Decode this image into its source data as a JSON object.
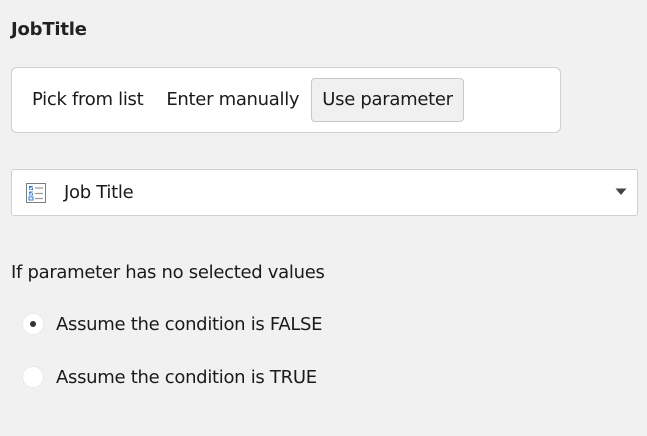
{
  "panel": {
    "title": "JobTitle"
  },
  "mode_options": {
    "pick_from_list": "Pick from list",
    "enter_manually": "Enter manually",
    "use_parameter": "Use parameter",
    "selected": "use_parameter"
  },
  "parameter_select": {
    "icon": "checklist-icon",
    "value": "Job Title"
  },
  "no_values": {
    "label": "If parameter has no selected values",
    "options": [
      {
        "label": "Assume the condition is FALSE",
        "checked": true
      },
      {
        "label": "Assume the condition is TRUE",
        "checked": false
      }
    ]
  },
  "colors": {
    "background": "#f1f1f1",
    "surface": "#ffffff",
    "border": "#d0d0d0",
    "icon_blue": "#2f7fd0"
  }
}
